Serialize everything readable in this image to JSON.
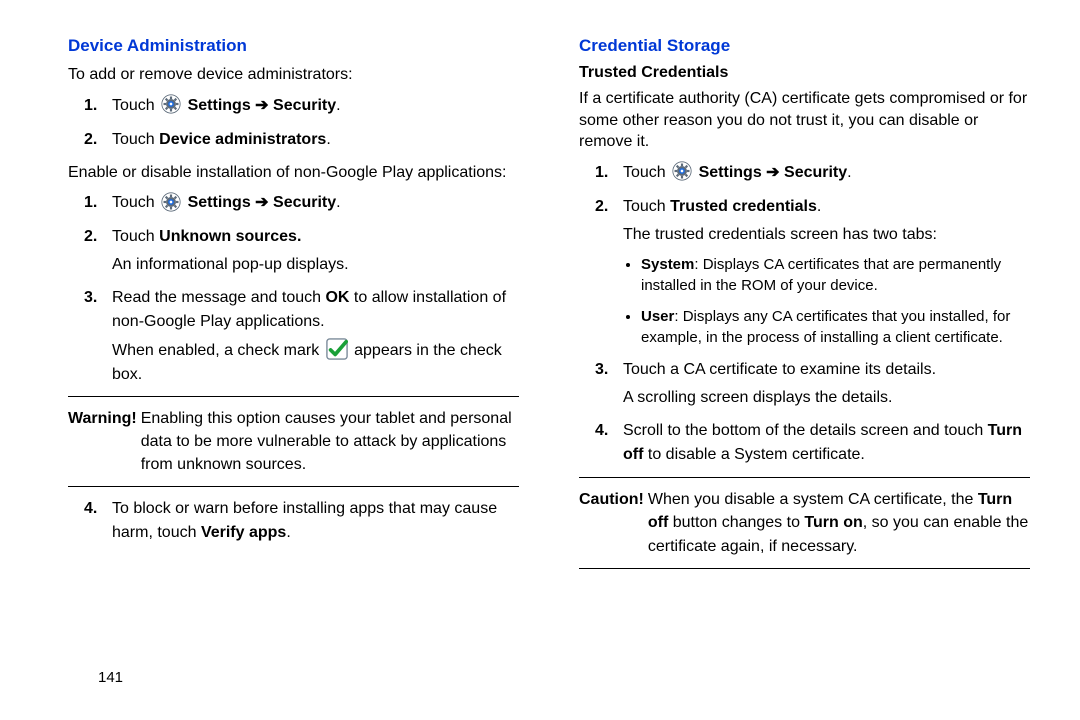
{
  "pageNumber": "141",
  "left": {
    "heading": "Device Administration",
    "intro1": "To add or remove device administrators:",
    "stepsA": {
      "s1_pre": "Touch ",
      "s1_settings": "Settings",
      "s1_arrow": " ➔ ",
      "s1_security": "Security",
      "s1_post": ".",
      "s2_pre": "Touch ",
      "s2_bold": "Device administrators",
      "s2_post": "."
    },
    "intro2": "Enable or disable installation of non-Google Play applications:",
    "stepsB": {
      "s1_pre": "Touch ",
      "s1_settings": "Settings",
      "s1_arrow": " ➔ ",
      "s1_security": "Security",
      "s1_post": ".",
      "s2_pre": "Touch ",
      "s2_bold": "Unknown sources.",
      "s2_follow": "An informational pop-up displays.",
      "s3_pre": "Read the message and touch ",
      "s3_ok": "OK",
      "s3_post": " to allow installation of non-Google Play applications.",
      "s3_follow_pre": "When enabled, a check mark ",
      "s3_follow_post": " appears in the check box."
    },
    "warning_label": "Warning!",
    "warning_body": "Enabling this option causes your tablet and personal data to be more vulnerable to attack by applications from unknown sources.",
    "stepsC": {
      "s4_pre": "To block or warn before installing apps that may cause harm, touch ",
      "s4_bold": "Verify apps",
      "s4_post": "."
    }
  },
  "right": {
    "heading": "Credential Storage",
    "subheading": "Trusted Credentials",
    "intro": "If a certificate authority (CA) certificate gets compromised or for some other reason you do not trust it, you can disable or remove it.",
    "steps": {
      "s1_pre": "Touch ",
      "s1_settings": "Settings",
      "s1_arrow": " ➔ ",
      "s1_security": "Security",
      "s1_post": ".",
      "s2_pre": "Touch ",
      "s2_bold": "Trusted credentials",
      "s2_post": ".",
      "s2_follow": "The trusted credentials screen has two tabs:",
      "bul1_label": "System",
      "bul1_body": ": Displays CA certificates that are permanently installed in the ROM of your device.",
      "bul2_label": "User",
      "bul2_body": ": Displays any CA certificates that you installed, for example, in the process of installing a client certificate.",
      "s3_line1": "Touch a CA certificate to examine its details.",
      "s3_line2": "A scrolling screen displays the details.",
      "s4_pre": "Scroll to the bottom of the details screen and touch ",
      "s4_bold": "Turn off",
      "s4_post": " to disable a System certificate."
    },
    "caution_label": "Caution!",
    "caution_pre": "When you disable a system CA certificate, the ",
    "caution_b1": "Turn off",
    "caution_mid": " button changes to ",
    "caution_b2": "Turn on",
    "caution_post": ", so you can enable the certificate again, if necessary."
  }
}
